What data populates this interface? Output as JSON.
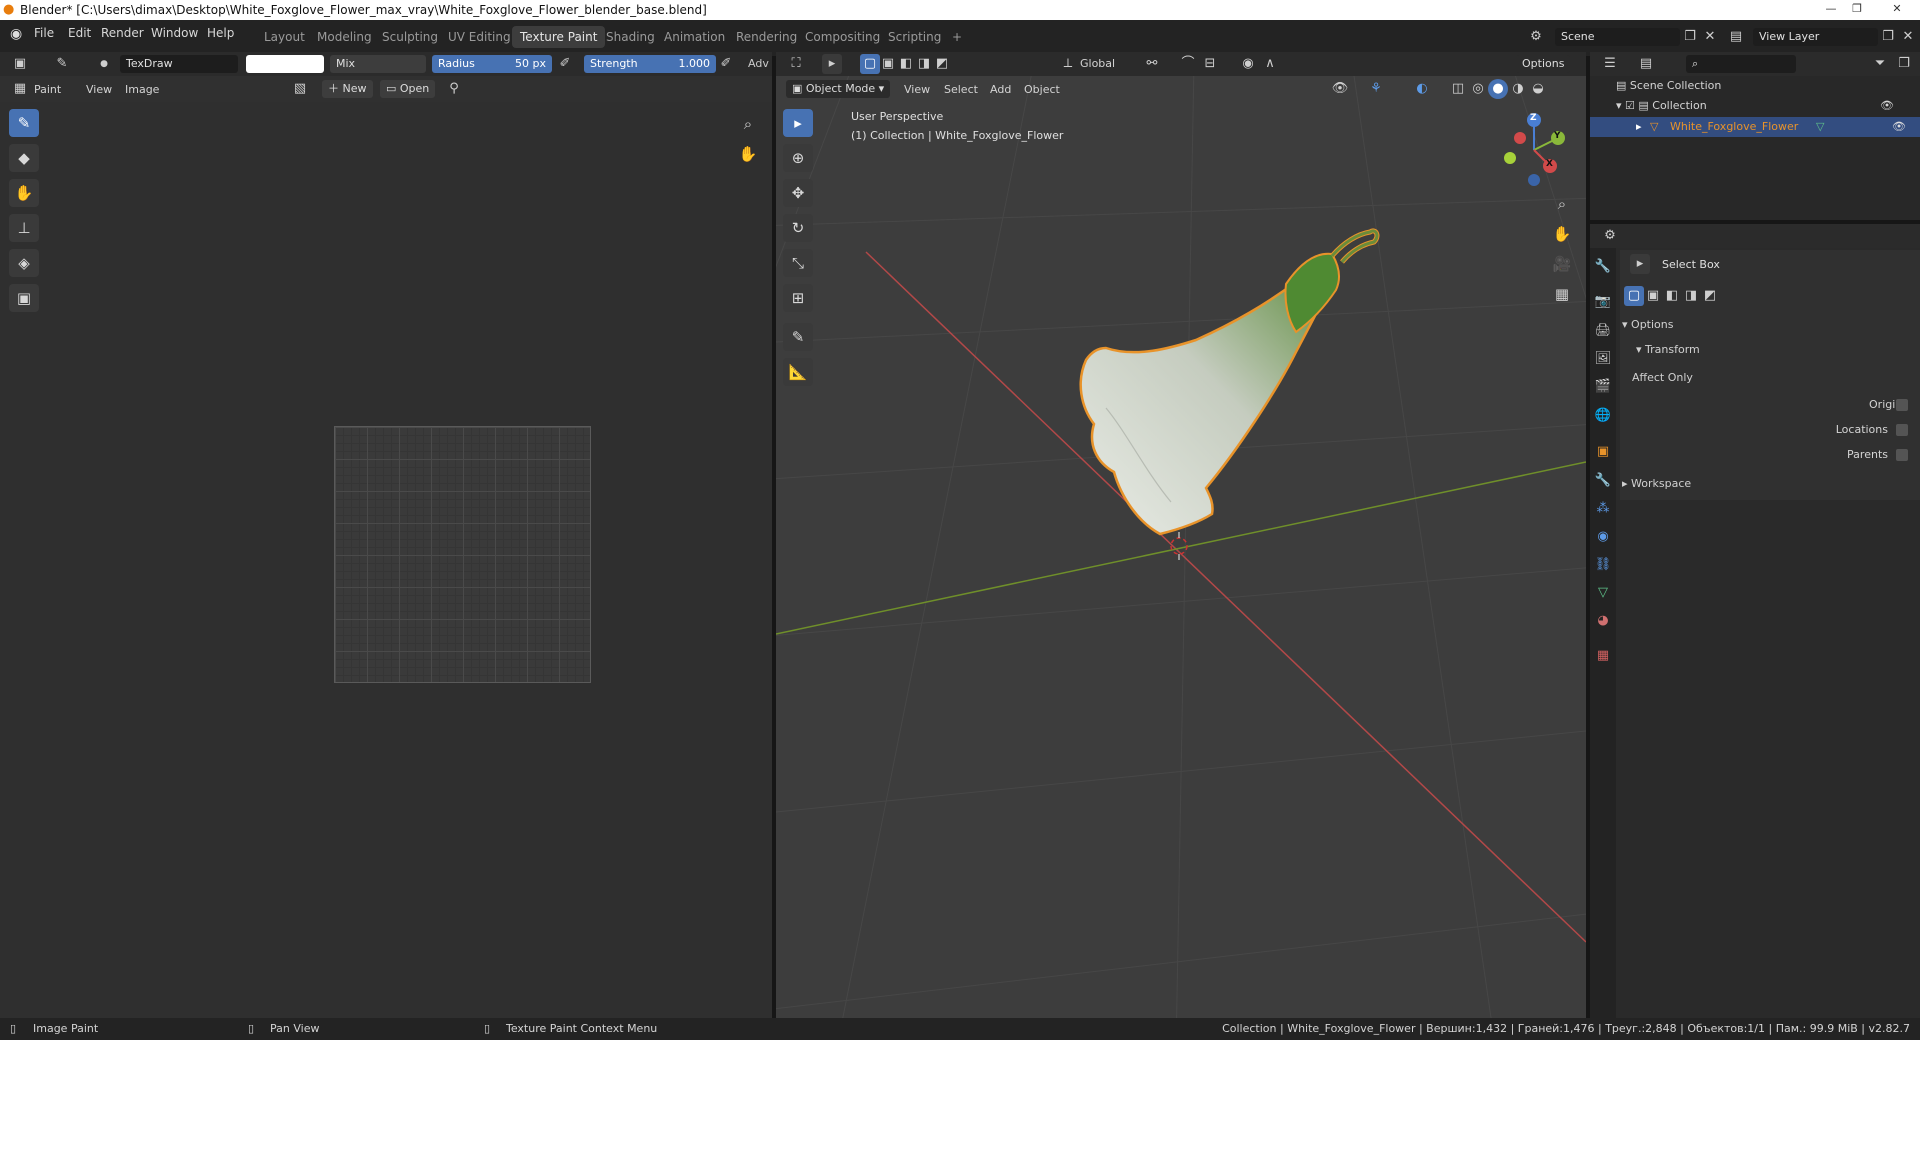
{
  "window": {
    "title": "Blender* [C:\\Users\\dimax\\Desktop\\White_Foxglove_Flower_max_vray\\White_Foxglove_Flower_blender_base.blend]",
    "minimize": "—",
    "maximize": "❐",
    "close": "✕"
  },
  "menu": [
    "File",
    "Edit",
    "Render",
    "Window",
    "Help"
  ],
  "workspaces": [
    "Layout",
    "Modeling",
    "Sculpting",
    "UV Editing",
    "Texture Paint",
    "Shading",
    "Animation",
    "Rendering",
    "Compositing",
    "Scripting",
    "+"
  ],
  "scene": {
    "label": "Scene",
    "view_layer": "View Layer"
  },
  "brush": {
    "name": "TexDraw",
    "blend": "Mix",
    "radius_label": "Radius",
    "radius_value": "50 px",
    "strength_label": "Strength",
    "strength_value": "1.000",
    "adv": "Adv"
  },
  "image_editor": {
    "mode": "Paint",
    "view": "View",
    "image": "Image",
    "new": "New",
    "open": "Open"
  },
  "viewport": {
    "orientation": "Global",
    "options": "Options",
    "mode": "Object Mode",
    "menus": [
      "View",
      "Select",
      "Add",
      "Object"
    ],
    "perspective": "User Perspective",
    "collection_info": "(1) Collection | White_Foxglove_Flower",
    "gizmo": {
      "z": "Z",
      "y": "Y",
      "x": "X"
    }
  },
  "outliner": {
    "scene_collection": "Scene Collection",
    "collection": "Collection",
    "object": "White_Foxglove_Flower"
  },
  "properties": {
    "tool": "Select Box",
    "options": "Options",
    "transform": "Transform",
    "affect_only": "Affect Only",
    "origins": "Origins",
    "locations": "Locations",
    "parents": "Parents",
    "workspace": "Workspace"
  },
  "status": {
    "left1": "Image Paint",
    "left2": "Pan View",
    "left3": "Texture Paint Context Menu",
    "right": "Collection | White_Foxglove_Flower | Вершин:1,432 | Граней:1,476 | Треуг.:2,848 | Объектов:1/1 | Пам.: 99.9 MiB | v2.82.7"
  },
  "colors": {
    "accent": "#4772b3",
    "selection_orange": "#e8932a",
    "x_axis": "#c44040",
    "y_axis": "#7a9a2c"
  }
}
